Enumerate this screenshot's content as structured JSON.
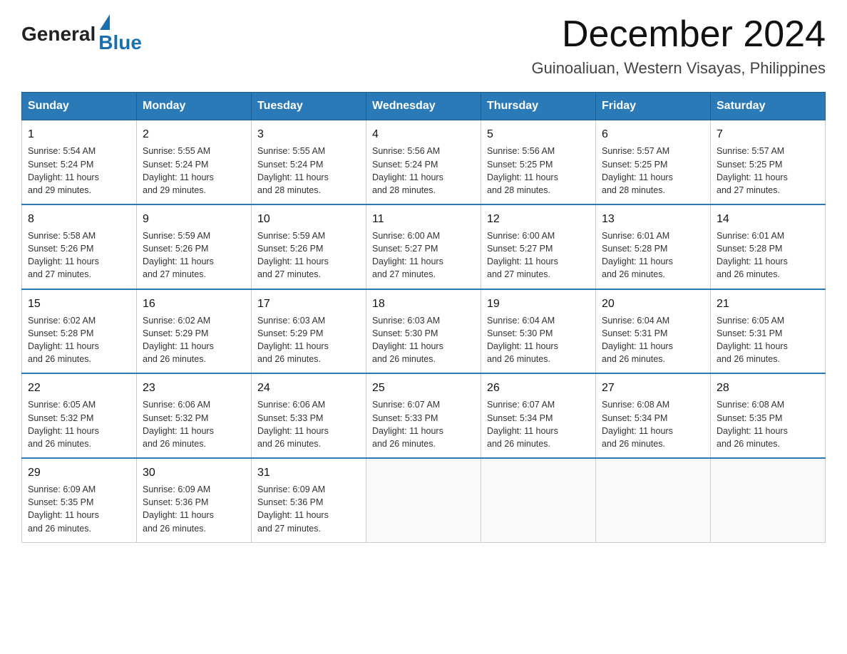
{
  "header": {
    "logo_general": "General",
    "logo_blue": "Blue",
    "month_title": "December 2024",
    "location": "Guinoaliuan, Western Visayas, Philippines"
  },
  "weekdays": [
    "Sunday",
    "Monday",
    "Tuesday",
    "Wednesday",
    "Thursday",
    "Friday",
    "Saturday"
  ],
  "weeks": [
    [
      {
        "day": "1",
        "sunrise": "5:54 AM",
        "sunset": "5:24 PM",
        "daylight": "11 hours and 29 minutes."
      },
      {
        "day": "2",
        "sunrise": "5:55 AM",
        "sunset": "5:24 PM",
        "daylight": "11 hours and 29 minutes."
      },
      {
        "day": "3",
        "sunrise": "5:55 AM",
        "sunset": "5:24 PM",
        "daylight": "11 hours and 28 minutes."
      },
      {
        "day": "4",
        "sunrise": "5:56 AM",
        "sunset": "5:24 PM",
        "daylight": "11 hours and 28 minutes."
      },
      {
        "day": "5",
        "sunrise": "5:56 AM",
        "sunset": "5:25 PM",
        "daylight": "11 hours and 28 minutes."
      },
      {
        "day": "6",
        "sunrise": "5:57 AM",
        "sunset": "5:25 PM",
        "daylight": "11 hours and 28 minutes."
      },
      {
        "day": "7",
        "sunrise": "5:57 AM",
        "sunset": "5:25 PM",
        "daylight": "11 hours and 27 minutes."
      }
    ],
    [
      {
        "day": "8",
        "sunrise": "5:58 AM",
        "sunset": "5:26 PM",
        "daylight": "11 hours and 27 minutes."
      },
      {
        "day": "9",
        "sunrise": "5:59 AM",
        "sunset": "5:26 PM",
        "daylight": "11 hours and 27 minutes."
      },
      {
        "day": "10",
        "sunrise": "5:59 AM",
        "sunset": "5:26 PM",
        "daylight": "11 hours and 27 minutes."
      },
      {
        "day": "11",
        "sunrise": "6:00 AM",
        "sunset": "5:27 PM",
        "daylight": "11 hours and 27 minutes."
      },
      {
        "day": "12",
        "sunrise": "6:00 AM",
        "sunset": "5:27 PM",
        "daylight": "11 hours and 27 minutes."
      },
      {
        "day": "13",
        "sunrise": "6:01 AM",
        "sunset": "5:28 PM",
        "daylight": "11 hours and 26 minutes."
      },
      {
        "day": "14",
        "sunrise": "6:01 AM",
        "sunset": "5:28 PM",
        "daylight": "11 hours and 26 minutes."
      }
    ],
    [
      {
        "day": "15",
        "sunrise": "6:02 AM",
        "sunset": "5:28 PM",
        "daylight": "11 hours and 26 minutes."
      },
      {
        "day": "16",
        "sunrise": "6:02 AM",
        "sunset": "5:29 PM",
        "daylight": "11 hours and 26 minutes."
      },
      {
        "day": "17",
        "sunrise": "6:03 AM",
        "sunset": "5:29 PM",
        "daylight": "11 hours and 26 minutes."
      },
      {
        "day": "18",
        "sunrise": "6:03 AM",
        "sunset": "5:30 PM",
        "daylight": "11 hours and 26 minutes."
      },
      {
        "day": "19",
        "sunrise": "6:04 AM",
        "sunset": "5:30 PM",
        "daylight": "11 hours and 26 minutes."
      },
      {
        "day": "20",
        "sunrise": "6:04 AM",
        "sunset": "5:31 PM",
        "daylight": "11 hours and 26 minutes."
      },
      {
        "day": "21",
        "sunrise": "6:05 AM",
        "sunset": "5:31 PM",
        "daylight": "11 hours and 26 minutes."
      }
    ],
    [
      {
        "day": "22",
        "sunrise": "6:05 AM",
        "sunset": "5:32 PM",
        "daylight": "11 hours and 26 minutes."
      },
      {
        "day": "23",
        "sunrise": "6:06 AM",
        "sunset": "5:32 PM",
        "daylight": "11 hours and 26 minutes."
      },
      {
        "day": "24",
        "sunrise": "6:06 AM",
        "sunset": "5:33 PM",
        "daylight": "11 hours and 26 minutes."
      },
      {
        "day": "25",
        "sunrise": "6:07 AM",
        "sunset": "5:33 PM",
        "daylight": "11 hours and 26 minutes."
      },
      {
        "day": "26",
        "sunrise": "6:07 AM",
        "sunset": "5:34 PM",
        "daylight": "11 hours and 26 minutes."
      },
      {
        "day": "27",
        "sunrise": "6:08 AM",
        "sunset": "5:34 PM",
        "daylight": "11 hours and 26 minutes."
      },
      {
        "day": "28",
        "sunrise": "6:08 AM",
        "sunset": "5:35 PM",
        "daylight": "11 hours and 26 minutes."
      }
    ],
    [
      {
        "day": "29",
        "sunrise": "6:09 AM",
        "sunset": "5:35 PM",
        "daylight": "11 hours and 26 minutes."
      },
      {
        "day": "30",
        "sunrise": "6:09 AM",
        "sunset": "5:36 PM",
        "daylight": "11 hours and 26 minutes."
      },
      {
        "day": "31",
        "sunrise": "6:09 AM",
        "sunset": "5:36 PM",
        "daylight": "11 hours and 27 minutes."
      },
      null,
      null,
      null,
      null
    ]
  ]
}
